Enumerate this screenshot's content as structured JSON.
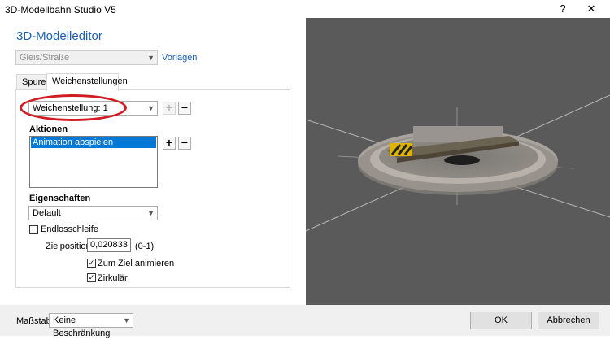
{
  "window": {
    "title": "3D-Modellbahn Studio V5",
    "help_symbol": "?",
    "close_symbol": "✕"
  },
  "editor": {
    "heading": "3D-Modelleditor",
    "category_select": "Gleis/Straße",
    "templates_link": "Vorlagen",
    "tabs": [
      {
        "label": "Spuren"
      },
      {
        "label": "Weichenstellungen"
      }
    ],
    "switch_setting_select": "Weichenstellung: 1",
    "actions_label": "Aktionen",
    "actions_items": [
      "Animation abspielen"
    ],
    "properties_label": "Eigenschaften",
    "properties_select": "Default",
    "endless_loop_label": "Endlosschleife",
    "endless_loop_checked": false,
    "target_position_label": "Zielposition:",
    "target_position_value": "0,020833",
    "target_position_range": "(0-1)",
    "animate_to_target_label": "Zum Ziel animieren",
    "animate_to_target_checked": true,
    "circular_label": "Zirkulär",
    "circular_checked": true,
    "plus_symbol": "+",
    "minus_symbol": "−"
  },
  "footer": {
    "scale_label": "Maßstab:",
    "scale_select": "Keine Beschränkung",
    "ok_label": "OK",
    "cancel_label": "Abbrechen"
  },
  "colors": {
    "accent": "#1a5fb4",
    "highlight_ellipse": "#d01c22",
    "viewport_bg": "#5a5a5a",
    "selection": "#0078d7"
  },
  "icons": [
    "help-icon",
    "close-icon",
    "chevron-down-icon",
    "plus-icon",
    "minus-icon",
    "checkmark-icon"
  ]
}
